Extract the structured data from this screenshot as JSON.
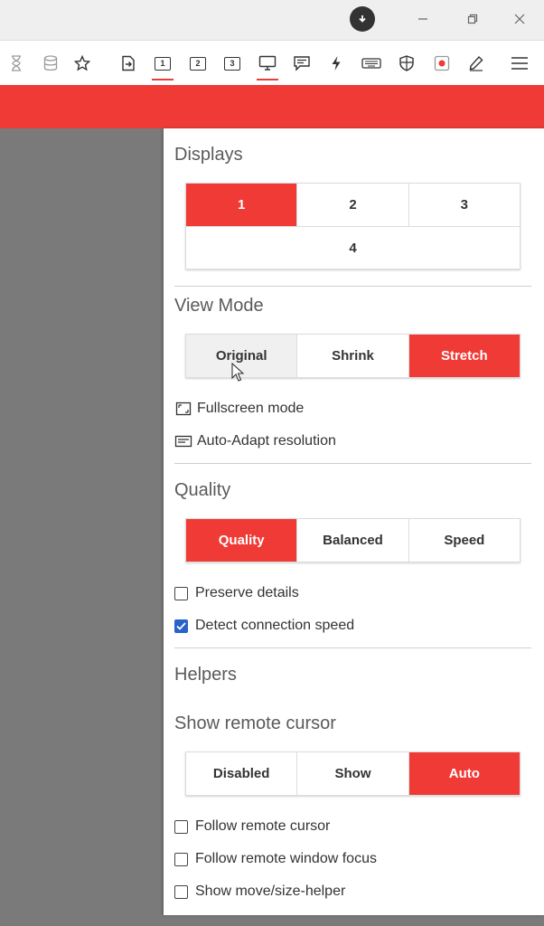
{
  "toolbar": {
    "icons": [
      "hourglass-icon",
      "database-icon",
      "star-icon",
      "file-transfer-icon",
      "monitor-1-icon",
      "monitor-2-icon",
      "monitor-3-icon",
      "monitor-all-icon",
      "chat-icon",
      "lightning-icon",
      "keyboard-icon",
      "shield-icon",
      "record-icon",
      "pen-icon",
      "menu-icon"
    ],
    "monitor_labels": [
      "1",
      "2",
      "3"
    ]
  },
  "colors": {
    "accent": "#ef3a36",
    "checkbox": "#2962c9"
  },
  "panel": {
    "displays": {
      "title": "Displays",
      "options": [
        "1",
        "2",
        "3",
        "4"
      ],
      "selected": "1"
    },
    "view_mode": {
      "title": "View Mode",
      "options": [
        "Original",
        "Shrink",
        "Stretch"
      ],
      "selected": "Stretch",
      "fullscreen_label": "Fullscreen mode",
      "auto_adapt_label": "Auto-Adapt resolution"
    },
    "quality": {
      "title": "Quality",
      "options": [
        "Quality",
        "Balanced",
        "Speed"
      ],
      "selected": "Quality",
      "preserve_details_label": "Preserve details",
      "preserve_details_checked": false,
      "detect_speed_label": "Detect connection speed",
      "detect_speed_checked": true
    },
    "helpers": {
      "title": "Helpers",
      "show_cursor_title": "Show remote cursor",
      "cursor_options": [
        "Disabled",
        "Show",
        "Auto"
      ],
      "selected": "Auto",
      "follow_cursor_label": "Follow remote cursor",
      "follow_cursor_checked": false,
      "follow_focus_label": "Follow remote window focus",
      "follow_focus_checked": false,
      "move_size_label": "Show move/size-helper",
      "move_size_checked": false
    }
  }
}
